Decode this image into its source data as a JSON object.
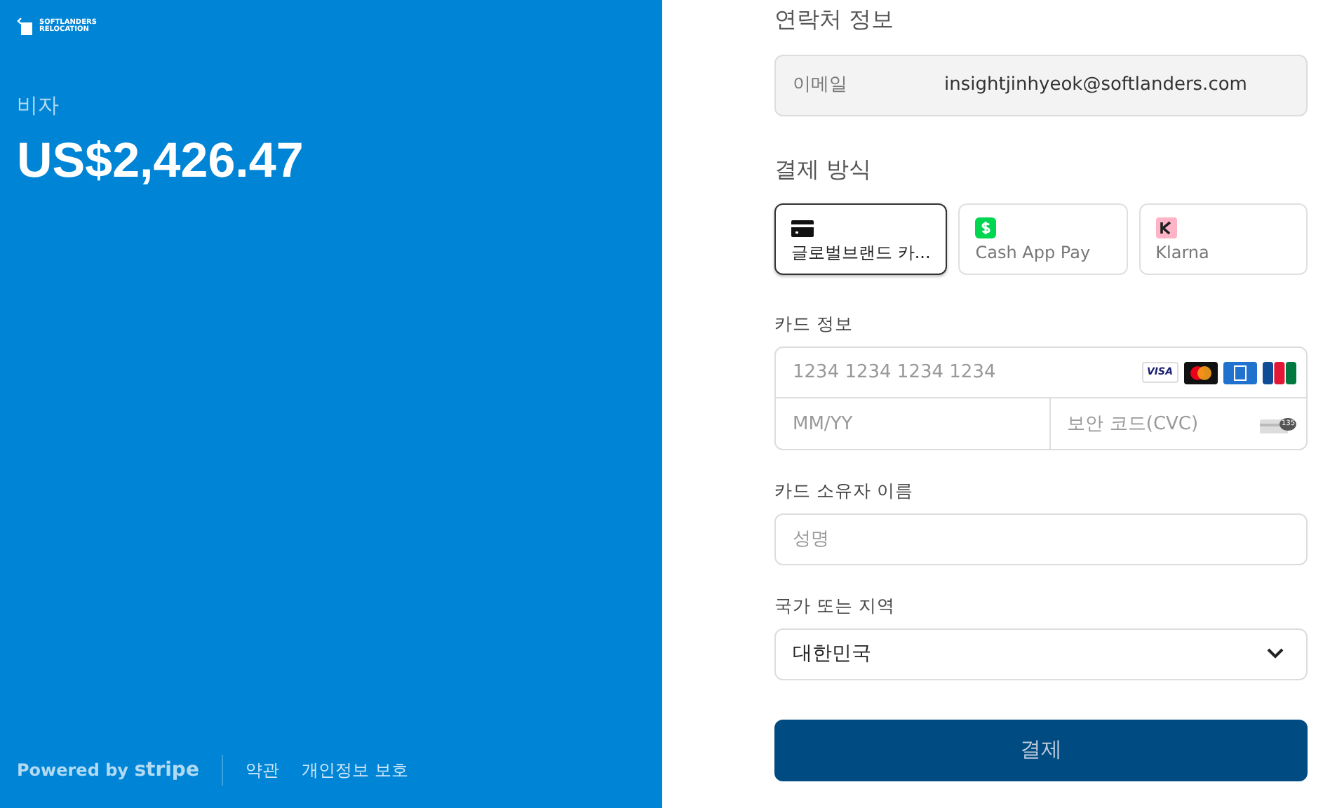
{
  "merchant": {
    "logo_name": "SOFTLANDERS",
    "logo_sub": "RELOCATION",
    "product": "비자",
    "amount": "US$2,426.47"
  },
  "footer": {
    "powered_by": "Powered by",
    "brand": "stripe",
    "links": [
      "약관",
      "개인정보 보호"
    ]
  },
  "contact": {
    "heading": "연락처 정보",
    "email_label": "이메일",
    "email": "insightjinhyeok@softlanders.com"
  },
  "payment": {
    "heading": "결제 방식",
    "methods": [
      {
        "kind": "card",
        "label": "글로벌브랜드 카...",
        "selected": true
      },
      {
        "kind": "cashapp",
        "label": "Cash App Pay",
        "selected": false
      },
      {
        "kind": "klarna",
        "label": "Klarna",
        "selected": false
      }
    ]
  },
  "card": {
    "label": "카드 정보",
    "number_placeholder": "1234 1234 1234 1234",
    "visa": "VISA",
    "expiry_placeholder": "MM/YY",
    "cvc_placeholder": "보안 코드(CVC)",
    "cvc_badge": "135"
  },
  "holder": {
    "label": "카드 소유자 이름",
    "placeholder": "성명"
  },
  "country": {
    "label": "국가 또는 지역",
    "value": "대한민국"
  },
  "submit": "결제"
}
